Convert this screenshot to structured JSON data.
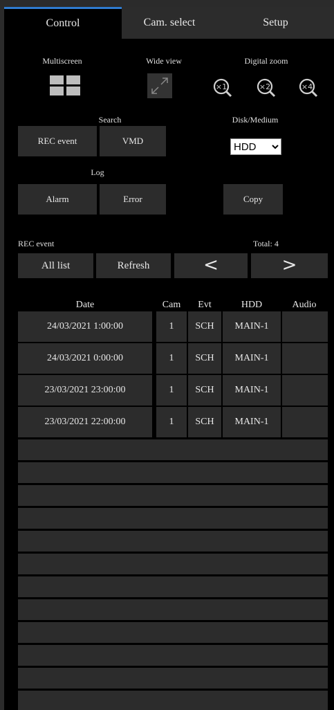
{
  "tabs": [
    {
      "label": "Control",
      "active": true
    },
    {
      "label": "Cam. select",
      "active": false
    },
    {
      "label": "Setup",
      "active": false
    }
  ],
  "sections": {
    "multiscreen": "Multiscreen",
    "wide_view": "Wide view",
    "digital_zoom": "Digital zoom",
    "search": "Search",
    "disk_medium": "Disk/Medium",
    "log": "Log",
    "rec_event": "REC event",
    "total_label": "Total:",
    "total_value": "4"
  },
  "buttons": {
    "rec_event": "REC event",
    "vmd": "VMD",
    "alarm": "Alarm",
    "error": "Error",
    "copy": "Copy",
    "all_list": "All list",
    "refresh": "Refresh",
    "prev": "<",
    "next": ">"
  },
  "zoom_levels": [
    "×1",
    "×2",
    "×4"
  ],
  "disk_select": {
    "value": "HDD"
  },
  "table": {
    "headers": [
      "Date",
      "Cam",
      "Evt",
      "HDD",
      "Audio"
    ],
    "rows": [
      {
        "date": "24/03/2021   1:00:00",
        "cam": "1",
        "evt": "SCH",
        "hdd": "MAIN-1",
        "audio": ""
      },
      {
        "date": "24/03/2021   0:00:00",
        "cam": "1",
        "evt": "SCH",
        "hdd": "MAIN-1",
        "audio": ""
      },
      {
        "date": "23/03/2021  23:00:00",
        "cam": "1",
        "evt": "SCH",
        "hdd": "MAIN-1",
        "audio": ""
      },
      {
        "date": "23/03/2021  22:00:00",
        "cam": "1",
        "evt": "SCH",
        "hdd": "MAIN-1",
        "audio": ""
      }
    ]
  },
  "colors": {
    "accent": "#2f7bd0",
    "panel": "#000000",
    "button": "#2c2c2c"
  }
}
